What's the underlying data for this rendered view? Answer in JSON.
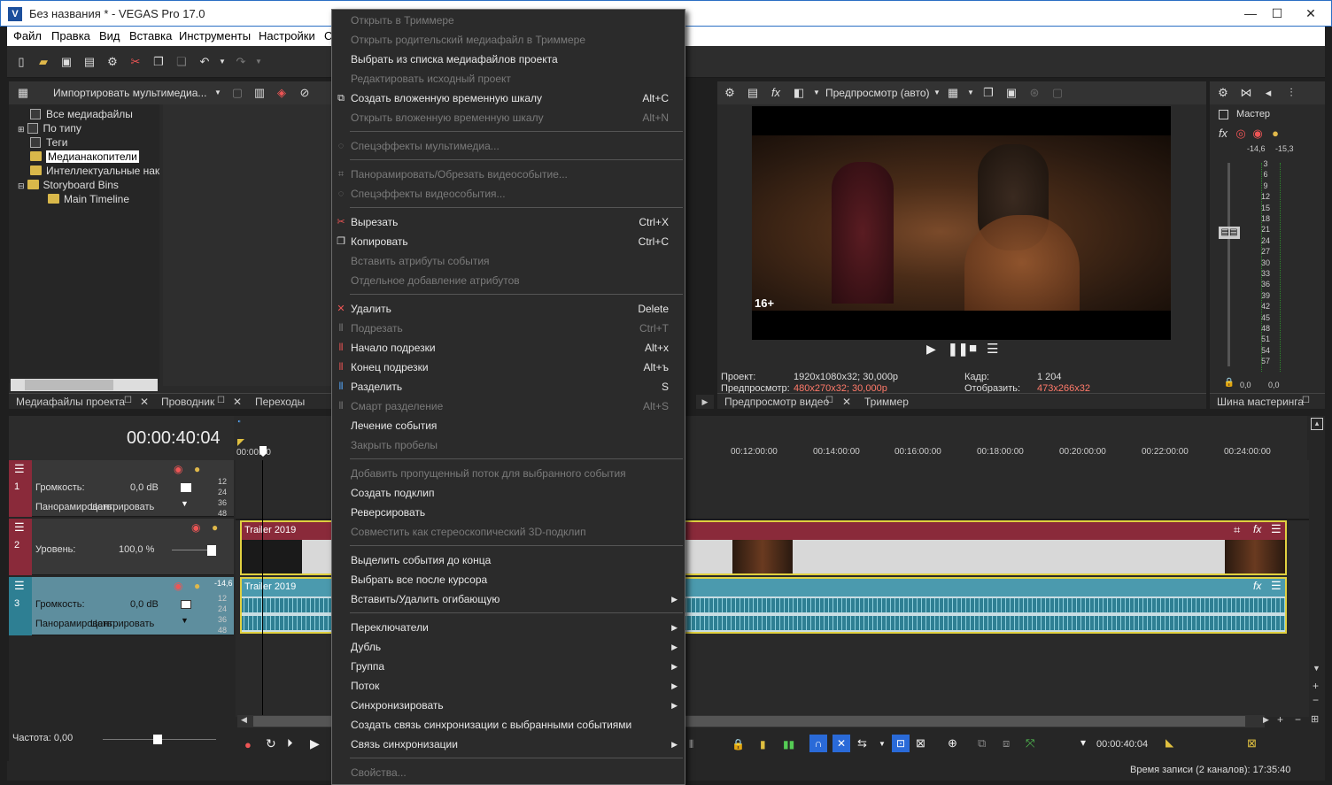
{
  "window": {
    "title": "Без названия * - VEGAS Pro 17.0",
    "minimize": "—",
    "maximize": "☐",
    "close": "✕"
  },
  "menu": [
    "Файл",
    "Правка",
    "Вид",
    "Вставка",
    "Инструменты",
    "Настройки",
    "С"
  ],
  "explorer": {
    "import_label": "Импортировать мультимедиа...",
    "tree": [
      "Все медиафайлы",
      "По типу",
      "Теги",
      "Медианакопители",
      "Интеллектуальные нак",
      "Storyboard Bins",
      "Main Timeline"
    ],
    "tabs": [
      "Медиафайлы проекта",
      "Проводник",
      "Переходы"
    ]
  },
  "preview": {
    "mode": "Предпросмотр (авто)",
    "rating": "16+",
    "project_label": "Проект:",
    "project_value": "1920x1080x32; 30,000p",
    "preview_label": "Предпросмотр:",
    "preview_value": "480x270x32; 30,000p",
    "frame_label": "Кадр:",
    "frame_value": "1 204",
    "display_label": "Отобразить:",
    "display_value": "473x266x32",
    "tabs": [
      "Предпросмотр видео",
      "Триммер"
    ]
  },
  "master": {
    "title": "Мастер",
    "peak_l": "-14,6",
    "peak_r": "-15,3",
    "scale": [
      "3",
      "6",
      "9",
      "12",
      "15",
      "18",
      "21",
      "24",
      "27",
      "30",
      "33",
      "36",
      "39",
      "42",
      "45",
      "48",
      "51",
      "54",
      "57"
    ],
    "bottom_l": "0,0",
    "bottom_r": "0,0",
    "tab": "Шина мастеринга"
  },
  "timeline": {
    "timecode": "00:00:40:04",
    "ruler_start": "00:00:00",
    "ruler": [
      "00:12:00:00",
      "00:14:00:00",
      "00:16:00:00",
      "00:18:00:00",
      "00:20:00:00",
      "00:22:00:00",
      "00:24:00:00"
    ],
    "track_scale": [
      "12",
      "24",
      "36",
      "48"
    ],
    "track1": {
      "num": "1",
      "vol_label": "Громкость:",
      "vol_value": "0,0 dB",
      "pan_label": "Панорамировать:",
      "pan_value": "Центрировать"
    },
    "track2": {
      "num": "2",
      "level_label": "Уровень:",
      "level_value": "100,0 %",
      "clip": "Trailer 2019"
    },
    "track3": {
      "num": "3",
      "vol_label": "Громкость:",
      "vol_value": "0,0 dB",
      "pan_label": "Панорамировать:",
      "pan_value": "Центрировать",
      "clip": "Trailer 2019",
      "peak": "-14,6"
    },
    "rate_label": "Частота: 0,00",
    "cursor_time": "00:00:40:04",
    "record_time": "Время записи (2 каналов): 17:35:40"
  },
  "context_menu": {
    "items": [
      {
        "label": "Открыть в Триммере",
        "shortcut": "",
        "disabled": true
      },
      {
        "label": "Открыть родительский медиафайл в Триммере",
        "shortcut": "",
        "disabled": true
      },
      {
        "label": "Выбрать из списка медиафайлов проекта",
        "shortcut": "",
        "disabled": false
      },
      {
        "label": "Редактировать исходный проект",
        "shortcut": "",
        "disabled": true
      },
      {
        "label": "Создать вложенную временную шкалу",
        "shortcut": "Alt+C",
        "disabled": false
      },
      {
        "label": "Открыть вложенную временную шкалу",
        "shortcut": "Alt+N",
        "disabled": true
      },
      {
        "label": "Спецэффекты мультимедиа...",
        "shortcut": "",
        "disabled": true
      },
      {
        "label": "Панорамировать/Обрезать видеособытие...",
        "shortcut": "",
        "disabled": true
      },
      {
        "label": "Спецэффекты видеособытия...",
        "shortcut": "",
        "disabled": true
      },
      {
        "label": "Вырезать",
        "shortcut": "Ctrl+X",
        "disabled": false
      },
      {
        "label": "Копировать",
        "shortcut": "Ctrl+C",
        "disabled": false
      },
      {
        "label": "Вставить атрибуты события",
        "shortcut": "",
        "disabled": true
      },
      {
        "label": "Отдельное добавление атрибутов",
        "shortcut": "",
        "disabled": true
      },
      {
        "label": "Удалить",
        "shortcut": "Delete",
        "disabled": false
      },
      {
        "label": "Подрезать",
        "shortcut": "Ctrl+T",
        "disabled": true
      },
      {
        "label": "Начало подрезки",
        "shortcut": "Alt+x",
        "disabled": false
      },
      {
        "label": "Конец подрезки",
        "shortcut": "Alt+ъ",
        "disabled": false
      },
      {
        "label": "Разделить",
        "shortcut": "S",
        "disabled": false
      },
      {
        "label": "Смарт разделение",
        "shortcut": "Alt+S",
        "disabled": true
      },
      {
        "label": "Лечение события",
        "shortcut": "",
        "disabled": false
      },
      {
        "label": "Закрыть пробелы",
        "shortcut": "",
        "disabled": true
      },
      {
        "label": "Добавить пропущенный поток для выбранного события",
        "shortcut": "",
        "disabled": true
      },
      {
        "label": "Создать подклип",
        "shortcut": "",
        "disabled": false
      },
      {
        "label": "Реверсировать",
        "shortcut": "",
        "disabled": false
      },
      {
        "label": "Совместить как стереоскопический 3D-подклип",
        "shortcut": "",
        "disabled": true
      },
      {
        "label": "Выделить события до конца",
        "shortcut": "",
        "disabled": false
      },
      {
        "label": "Выбрать все после курсора",
        "shortcut": "",
        "disabled": false
      },
      {
        "label": "Вставить/Удалить огибающую",
        "shortcut": "",
        "disabled": false
      },
      {
        "label": "Переключатели",
        "shortcut": "",
        "disabled": false
      },
      {
        "label": "Дубль",
        "shortcut": "",
        "disabled": false
      },
      {
        "label": "Группа",
        "shortcut": "",
        "disabled": false
      },
      {
        "label": "Поток",
        "shortcut": "",
        "disabled": false
      },
      {
        "label": "Синхронизировать",
        "shortcut": "",
        "disabled": false
      },
      {
        "label": "Создать связь синхронизации с выбранными событиями",
        "shortcut": "",
        "disabled": false
      },
      {
        "label": "Связь синхронизации",
        "shortcut": "",
        "disabled": false
      },
      {
        "label": "Свойства...",
        "shortcut": "",
        "disabled": true
      }
    ]
  }
}
